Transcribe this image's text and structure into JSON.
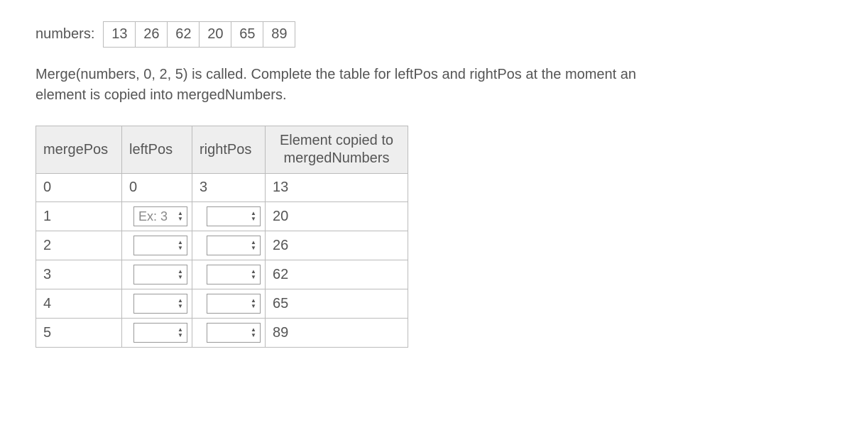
{
  "numbers_label": "numbers:",
  "numbers": [
    "13",
    "26",
    "62",
    "20",
    "65",
    "89"
  ],
  "instructions": "Merge(numbers, 0, 2, 5) is called. Complete the table for leftPos and rightPos at the moment an element is copied into mergedNumbers.",
  "headers": {
    "mergePos": "mergePos",
    "leftPos": "leftPos",
    "rightPos": "rightPos",
    "element_line1": "Element copied to",
    "element_line2": "mergedNumbers"
  },
  "rows": [
    {
      "mergePos": "0",
      "leftPos_static": "0",
      "rightPos_static": "3",
      "element": "13"
    },
    {
      "mergePos": "1",
      "leftPos_placeholder": "Ex: 3",
      "element": "20"
    },
    {
      "mergePos": "2",
      "element": "26"
    },
    {
      "mergePos": "3",
      "element": "62"
    },
    {
      "mergePos": "4",
      "element": "65"
    },
    {
      "mergePos": "5",
      "element": "89"
    }
  ]
}
